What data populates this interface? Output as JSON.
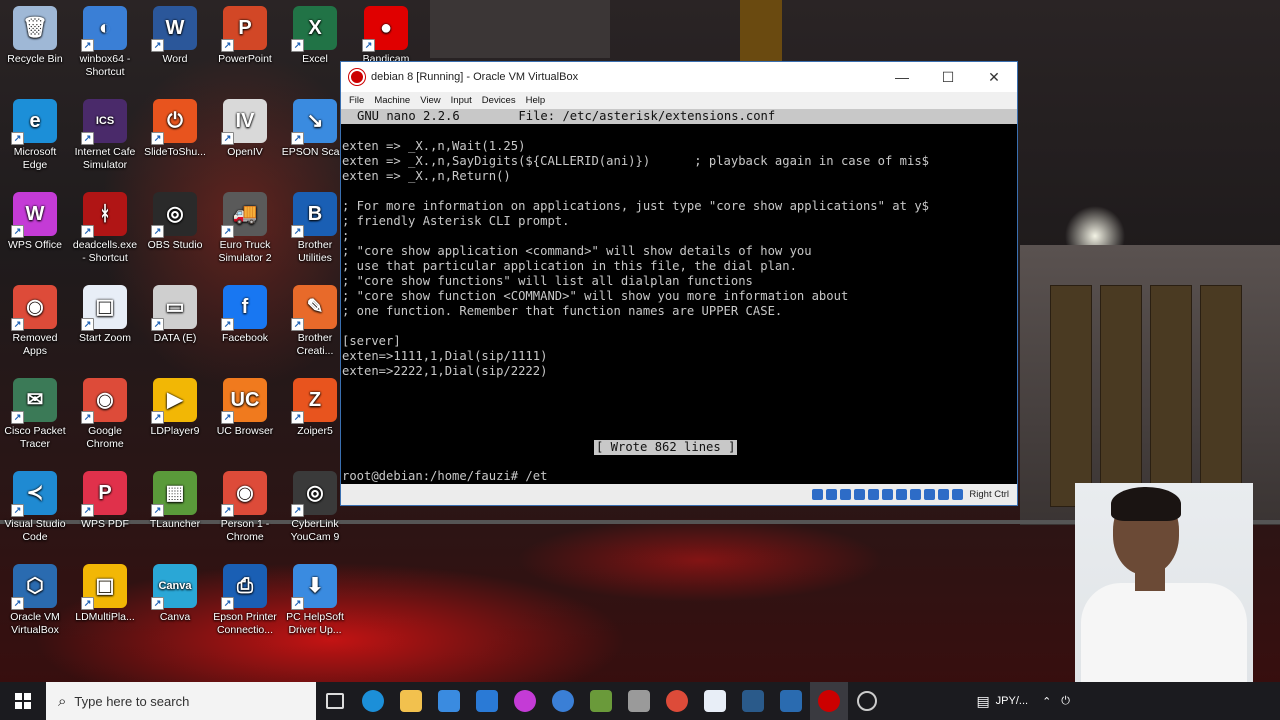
{
  "desktop_icons": [
    {
      "label": "Recycle Bin",
      "color": "#9fb8d6",
      "glyph": "🗑"
    },
    {
      "label": "winbox64 - Shortcut",
      "color": "#3a7fd6",
      "glyph": "◐"
    },
    {
      "label": "Word",
      "color": "#2b579a",
      "glyph": "W"
    },
    {
      "label": "PowerPoint",
      "color": "#d24726",
      "glyph": "P"
    },
    {
      "label": "Excel",
      "color": "#217346",
      "glyph": "X"
    },
    {
      "label": "Bandicam",
      "color": "#e00000",
      "glyph": "●"
    },
    {
      "label": "Microsoft Edge",
      "color": "#1c8fd8",
      "glyph": "e"
    },
    {
      "label": "Internet Cafe Simulator",
      "color": "#4a2a6a",
      "glyph": "ICS"
    },
    {
      "label": "SlideToShu...",
      "color": "#e8541e",
      "glyph": "⏻"
    },
    {
      "label": "OpenIV",
      "color": "#d9d9d9",
      "glyph": "IV"
    },
    {
      "label": "EPSON Sca...",
      "color": "#3a8be0",
      "glyph": "↘"
    },
    {
      "label": "WPS Office",
      "color": "#c43bd6",
      "glyph": "W"
    },
    {
      "label": "deadcells.exe - Shortcut",
      "color": "#b01515",
      "glyph": "ᚼ"
    },
    {
      "label": "OBS Studio",
      "color": "#2a2a2a",
      "glyph": "◎"
    },
    {
      "label": "Euro Truck Simulator 2",
      "color": "#5a5a5a",
      "glyph": "🚚"
    },
    {
      "label": "Brother Utilities",
      "color": "#1a5fb4",
      "glyph": "B"
    },
    {
      "label": "Removed Apps",
      "color": "#dd4b39",
      "glyph": "◉"
    },
    {
      "label": "Start Zoom",
      "color": "#e8eef7",
      "glyph": "▣"
    },
    {
      "label": "DATA (E)",
      "color": "#cfcfcf",
      "glyph": "▭"
    },
    {
      "label": "Facebook",
      "color": "#1877f2",
      "glyph": "f"
    },
    {
      "label": "Brother Creati...",
      "color": "#e86a2a",
      "glyph": "✎"
    },
    {
      "label": "Cisco Packet Tracer",
      "color": "#3b7a57",
      "glyph": "✉"
    },
    {
      "label": "Google Chrome",
      "color": "#dd4b39",
      "glyph": "◉"
    },
    {
      "label": "LDPlayer9",
      "color": "#f2b705",
      "glyph": "▶"
    },
    {
      "label": "UC Browser",
      "color": "#f07a1e",
      "glyph": "UC"
    },
    {
      "label": "Zoiper5",
      "color": "#e8541e",
      "glyph": "Z"
    },
    {
      "label": "Visual Studio Code",
      "color": "#1f8ad2",
      "glyph": "≺"
    },
    {
      "label": "WPS PDF",
      "color": "#e0314b",
      "glyph": "P"
    },
    {
      "label": "TLauncher",
      "color": "#5a9a3a",
      "glyph": "▦"
    },
    {
      "label": "Person 1 - Chrome",
      "color": "#dd4b39",
      "glyph": "◉"
    },
    {
      "label": "CyberLink YouCam 9",
      "color": "#3a3a3a",
      "glyph": "◎"
    },
    {
      "label": "Oracle VM VirtualBox",
      "color": "#2a6bb0",
      "glyph": "⬡"
    },
    {
      "label": "LDMultiPla...",
      "color": "#f2b705",
      "glyph": "▣"
    },
    {
      "label": "Canva",
      "color": "#2aa7d6",
      "glyph": "Canva"
    },
    {
      "label": "Epson Printer Connectio...",
      "color": "#1a5fb4",
      "glyph": "⎙"
    },
    {
      "label": "PC HelpSoft Driver Up...",
      "color": "#3a8be0",
      "glyph": "⬇"
    }
  ],
  "window": {
    "title": "debian 8 [Running] - Oracle VM VirtualBox",
    "minimize": "—",
    "maximize": "☐",
    "close": "✕",
    "menu": [
      "File",
      "Machine",
      "View",
      "Input",
      "Devices",
      "Help"
    ],
    "status_right": "Right Ctrl"
  },
  "terminal": {
    "header": "GNU nano 2.2.6        File: /etc/asterisk/extensions.conf",
    "lines": [
      "exten => _X.,n,Wait(1.25)",
      "exten => _X.,n,SayDigits(${CALLERID(ani)})      ; playback again in case of mis$",
      "exten => _X.,n,Return()",
      "",
      "; For more information on applications, just type \"core show applications\" at y$",
      "; friendly Asterisk CLI prompt.",
      ";",
      "; \"core show application <command>\" will show details of how you",
      "; use that particular application in this file, the dial plan.",
      "; \"core show functions\" will list all dialplan functions",
      "; \"core show function <COMMAND>\" will show you more information about",
      "; one function. Remember that function names are UPPER CASE.",
      "",
      "[server]",
      "exten=>1111,1,Dial(sip/1111)",
      "exten=>2222,1,Dial(sip/2222)"
    ],
    "wrote": "[ Wrote 862 lines ]",
    "prompt": "root@debian:/home/fauzi# /et"
  },
  "taskbar": {
    "search_placeholder": "Type here to search",
    "tray_text": "JPY/..."
  }
}
